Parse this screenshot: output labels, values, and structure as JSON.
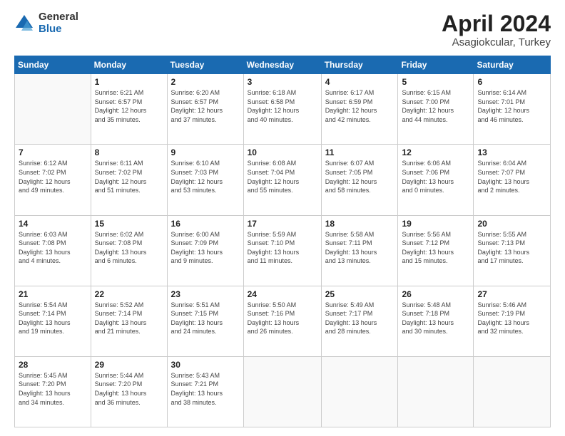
{
  "header": {
    "logo_general": "General",
    "logo_blue": "Blue",
    "month_title": "April 2024",
    "subtitle": "Asagiokcular, Turkey"
  },
  "weekdays": [
    "Sunday",
    "Monday",
    "Tuesday",
    "Wednesday",
    "Thursday",
    "Friday",
    "Saturday"
  ],
  "weeks": [
    [
      {
        "day": "",
        "info": ""
      },
      {
        "day": "1",
        "info": "Sunrise: 6:21 AM\nSunset: 6:57 PM\nDaylight: 12 hours\nand 35 minutes."
      },
      {
        "day": "2",
        "info": "Sunrise: 6:20 AM\nSunset: 6:57 PM\nDaylight: 12 hours\nand 37 minutes."
      },
      {
        "day": "3",
        "info": "Sunrise: 6:18 AM\nSunset: 6:58 PM\nDaylight: 12 hours\nand 40 minutes."
      },
      {
        "day": "4",
        "info": "Sunrise: 6:17 AM\nSunset: 6:59 PM\nDaylight: 12 hours\nand 42 minutes."
      },
      {
        "day": "5",
        "info": "Sunrise: 6:15 AM\nSunset: 7:00 PM\nDaylight: 12 hours\nand 44 minutes."
      },
      {
        "day": "6",
        "info": "Sunrise: 6:14 AM\nSunset: 7:01 PM\nDaylight: 12 hours\nand 46 minutes."
      }
    ],
    [
      {
        "day": "7",
        "info": "Sunrise: 6:12 AM\nSunset: 7:02 PM\nDaylight: 12 hours\nand 49 minutes."
      },
      {
        "day": "8",
        "info": "Sunrise: 6:11 AM\nSunset: 7:02 PM\nDaylight: 12 hours\nand 51 minutes."
      },
      {
        "day": "9",
        "info": "Sunrise: 6:10 AM\nSunset: 7:03 PM\nDaylight: 12 hours\nand 53 minutes."
      },
      {
        "day": "10",
        "info": "Sunrise: 6:08 AM\nSunset: 7:04 PM\nDaylight: 12 hours\nand 55 minutes."
      },
      {
        "day": "11",
        "info": "Sunrise: 6:07 AM\nSunset: 7:05 PM\nDaylight: 12 hours\nand 58 minutes."
      },
      {
        "day": "12",
        "info": "Sunrise: 6:06 AM\nSunset: 7:06 PM\nDaylight: 13 hours\nand 0 minutes."
      },
      {
        "day": "13",
        "info": "Sunrise: 6:04 AM\nSunset: 7:07 PM\nDaylight: 13 hours\nand 2 minutes."
      }
    ],
    [
      {
        "day": "14",
        "info": "Sunrise: 6:03 AM\nSunset: 7:08 PM\nDaylight: 13 hours\nand 4 minutes."
      },
      {
        "day": "15",
        "info": "Sunrise: 6:02 AM\nSunset: 7:08 PM\nDaylight: 13 hours\nand 6 minutes."
      },
      {
        "day": "16",
        "info": "Sunrise: 6:00 AM\nSunset: 7:09 PM\nDaylight: 13 hours\nand 9 minutes."
      },
      {
        "day": "17",
        "info": "Sunrise: 5:59 AM\nSunset: 7:10 PM\nDaylight: 13 hours\nand 11 minutes."
      },
      {
        "day": "18",
        "info": "Sunrise: 5:58 AM\nSunset: 7:11 PM\nDaylight: 13 hours\nand 13 minutes."
      },
      {
        "day": "19",
        "info": "Sunrise: 5:56 AM\nSunset: 7:12 PM\nDaylight: 13 hours\nand 15 minutes."
      },
      {
        "day": "20",
        "info": "Sunrise: 5:55 AM\nSunset: 7:13 PM\nDaylight: 13 hours\nand 17 minutes."
      }
    ],
    [
      {
        "day": "21",
        "info": "Sunrise: 5:54 AM\nSunset: 7:14 PM\nDaylight: 13 hours\nand 19 minutes."
      },
      {
        "day": "22",
        "info": "Sunrise: 5:52 AM\nSunset: 7:14 PM\nDaylight: 13 hours\nand 21 minutes."
      },
      {
        "day": "23",
        "info": "Sunrise: 5:51 AM\nSunset: 7:15 PM\nDaylight: 13 hours\nand 24 minutes."
      },
      {
        "day": "24",
        "info": "Sunrise: 5:50 AM\nSunset: 7:16 PM\nDaylight: 13 hours\nand 26 minutes."
      },
      {
        "day": "25",
        "info": "Sunrise: 5:49 AM\nSunset: 7:17 PM\nDaylight: 13 hours\nand 28 minutes."
      },
      {
        "day": "26",
        "info": "Sunrise: 5:48 AM\nSunset: 7:18 PM\nDaylight: 13 hours\nand 30 minutes."
      },
      {
        "day": "27",
        "info": "Sunrise: 5:46 AM\nSunset: 7:19 PM\nDaylight: 13 hours\nand 32 minutes."
      }
    ],
    [
      {
        "day": "28",
        "info": "Sunrise: 5:45 AM\nSunset: 7:20 PM\nDaylight: 13 hours\nand 34 minutes."
      },
      {
        "day": "29",
        "info": "Sunrise: 5:44 AM\nSunset: 7:20 PM\nDaylight: 13 hours\nand 36 minutes."
      },
      {
        "day": "30",
        "info": "Sunrise: 5:43 AM\nSunset: 7:21 PM\nDaylight: 13 hours\nand 38 minutes."
      },
      {
        "day": "",
        "info": ""
      },
      {
        "day": "",
        "info": ""
      },
      {
        "day": "",
        "info": ""
      },
      {
        "day": "",
        "info": ""
      }
    ]
  ]
}
